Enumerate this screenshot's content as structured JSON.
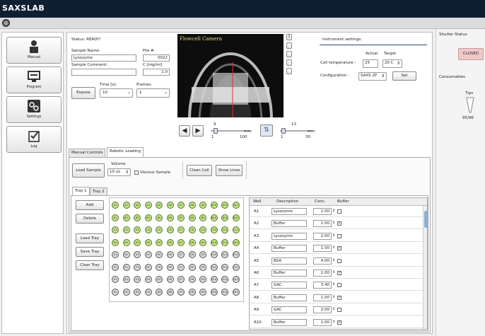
{
  "app": {
    "title": "SAXSLAB"
  },
  "sidebar": {
    "items": [
      {
        "label": "Manual",
        "icon": "person-icon"
      },
      {
        "label": "Program",
        "icon": "screen-icon"
      },
      {
        "label": "Settings",
        "icon": "gears-icon"
      },
      {
        "label": "Log",
        "icon": "checklist-icon"
      }
    ]
  },
  "status": {
    "text": "Status:  READY!"
  },
  "sample": {
    "name_label": "Sample Name:",
    "name_value": "Lysozyme",
    "file_label": "File #:",
    "file_value": "0022",
    "comment_label": "Sample Comment:",
    "comment_value": "",
    "conc_label": "C [mg/ml]",
    "conc_value": "1.0",
    "expose_label": "Expose",
    "time_label": "Time [s]:",
    "time_value": "10",
    "frames_label": "Frames:",
    "frames_value": "1"
  },
  "camera": {
    "title": "Flowcell Camera",
    "side_button_1": "1",
    "slider1_top": "9",
    "slider1_unit": "mm",
    "slider1_min": "1",
    "slider1_max": "100",
    "slider2_top": "13",
    "slider2_unit": "mm",
    "slider2_min": "1",
    "slider2_max": "30"
  },
  "instrument": {
    "title": "Instrument settings:",
    "actual_label": "Actual",
    "target_label": "Target",
    "temp_label": "Cell temperature :",
    "temp_actual": "25",
    "temp_target": "20 C",
    "config_label": "Configuration :",
    "config_value": "SAXS 2P",
    "set_label": "Set"
  },
  "tabs": {
    "manual": "Manual Controls",
    "robotic": "Robotic Loading"
  },
  "robotic": {
    "load_sample": "Load Sample",
    "volume_label": "Volume",
    "volume_value": "10 uL",
    "viscous_label": "Viscous Sample",
    "clean_cell": "Clean Cell",
    "show_lines": "Show Lines",
    "tray_tab_1": "Tray 1",
    "tray_tab_2": "Tray 2",
    "add": "Add",
    "delete": "Delete",
    "load_tray": "Load Tray",
    "save_tray": "Save Tray",
    "clear_tray": "Clear Tray"
  },
  "wells": {
    "rows": [
      [
        "A1",
        "A2",
        "A3",
        "A4",
        "A5",
        "A6",
        "A7",
        "A8",
        "A9",
        "A10",
        "A11",
        "A12"
      ],
      [
        "B1",
        "B2",
        "B3",
        "B4",
        "B5",
        "B6",
        "B7",
        "B8",
        "B9",
        "B10",
        "B11",
        "B12"
      ],
      [
        "C1",
        "C2",
        "C3",
        "C4",
        "C5",
        "C6",
        "C7",
        "C8",
        "C9",
        "C10",
        "C11",
        "C12"
      ],
      [
        "D1",
        "D2",
        "D3",
        "D4",
        "D5",
        "D6",
        "D7",
        "D8",
        "D9",
        "D10",
        "D11",
        "D12"
      ],
      [
        "E1",
        "E2",
        "E3",
        "E4",
        "E5",
        "E6",
        "E7",
        "E8",
        "E9",
        "E10",
        "E11",
        "E12"
      ],
      [
        "F1",
        "F2",
        "F3",
        "F4",
        "F5",
        "F6",
        "F7",
        "F8",
        "F9",
        "F10",
        "F11",
        "F12"
      ],
      [
        "G1",
        "G2",
        "G3",
        "G4",
        "G5",
        "G6",
        "G7",
        "G8",
        "G9",
        "G10",
        "G11",
        "G12"
      ],
      [
        "H1",
        "H2",
        "H3",
        "H4",
        "H5",
        "H6",
        "H7",
        "H8",
        "H9",
        "H10",
        "H11",
        "H12"
      ]
    ],
    "active_rows": 4
  },
  "table": {
    "headers": [
      "Well",
      "Description",
      "Conc.",
      "Buffer"
    ],
    "rows": [
      {
        "well": "A1",
        "desc": "Lysozyme",
        "conc": "1.00",
        "buffer": false
      },
      {
        "well": "A2",
        "desc": "Buffer",
        "conc": "1.00",
        "buffer": true
      },
      {
        "well": "A3",
        "desc": "Lysozyme",
        "conc": "2.00",
        "buffer": false
      },
      {
        "well": "A4",
        "desc": "Buffer",
        "conc": "1.00",
        "buffer": true
      },
      {
        "well": "A5",
        "desc": "BSA",
        "conc": "4.00",
        "buffer": false
      },
      {
        "well": "A6",
        "desc": "Buffer",
        "conc": "1.00",
        "buffer": true
      },
      {
        "well": "A7",
        "desc": "GAC",
        "conc": "3.40",
        "buffer": false
      },
      {
        "well": "A8",
        "desc": "Buffer",
        "conc": "1.00",
        "buffer": true
      },
      {
        "well": "A9",
        "desc": "GAC",
        "conc": "2.00",
        "buffer": false
      },
      {
        "well": "A10",
        "desc": "Buffer",
        "conc": "1.00",
        "buffer": true
      }
    ]
  },
  "right": {
    "shutter_title": "Shutter Status",
    "shutter_state": "CLOSED",
    "consumables_title": "Consumables",
    "tips_label": "Tips",
    "tips_count": "95/96"
  },
  "colors": {
    "titlebar": "#0f1f33",
    "well_active": "#c6e48b",
    "accent": "#4a7ab5"
  }
}
